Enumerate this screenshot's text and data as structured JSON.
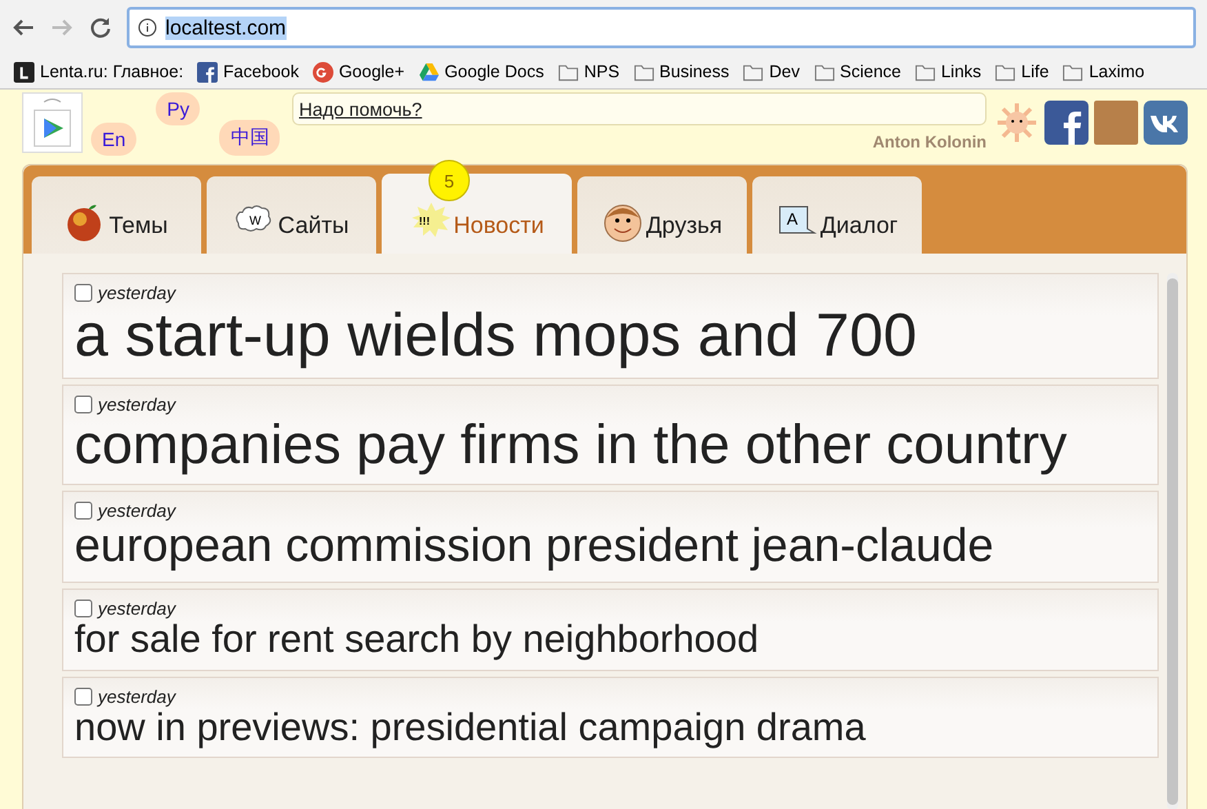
{
  "browser": {
    "url": "localtest.com",
    "bookmarks": [
      {
        "label": "Lenta.ru: Главное:",
        "kind": "lenta"
      },
      {
        "label": "Facebook",
        "kind": "facebook"
      },
      {
        "label": "Google+",
        "kind": "gplus"
      },
      {
        "label": "Google Docs",
        "kind": "drive"
      },
      {
        "label": "NPS",
        "kind": "folder"
      },
      {
        "label": "Business",
        "kind": "folder"
      },
      {
        "label": "Dev",
        "kind": "folder"
      },
      {
        "label": "Science",
        "kind": "folder"
      },
      {
        "label": "Links",
        "kind": "folder"
      },
      {
        "label": "Life",
        "kind": "folder"
      },
      {
        "label": "Laximo",
        "kind": "folder"
      }
    ]
  },
  "header": {
    "languages": [
      {
        "label": "En",
        "selected": false
      },
      {
        "label": "Ру",
        "selected": false
      },
      {
        "label": "中国",
        "selected": false
      }
    ],
    "help_link": "Надо помочь?",
    "user_name": "Anton Kolonin"
  },
  "tabs": [
    {
      "label": "Темы",
      "kind": "apple",
      "selected": false
    },
    {
      "label": "Сайты",
      "kind": "bubble",
      "icon_text": "W",
      "selected": false
    },
    {
      "label": "Новости",
      "kind": "burst",
      "icon_text": "!!!",
      "selected": true,
      "badge": "5"
    },
    {
      "label": "Друзья",
      "kind": "face",
      "selected": false
    },
    {
      "label": "Диалог",
      "kind": "dialog",
      "icon_text": "A",
      "selected": false
    }
  ],
  "news": [
    {
      "time": "yesterday",
      "title": "a start-up wields mops and 700",
      "checked": false
    },
    {
      "time": "yesterday",
      "title": "companies pay firms in the other country",
      "checked": false
    },
    {
      "time": "yesterday",
      "title": "european commission president jean-claude",
      "checked": false
    },
    {
      "time": "yesterday",
      "title": "for sale for rent search by neighborhood",
      "checked": false
    },
    {
      "time": "yesterday",
      "title": "now in previews: presidential campaign drama",
      "checked": false
    }
  ]
}
